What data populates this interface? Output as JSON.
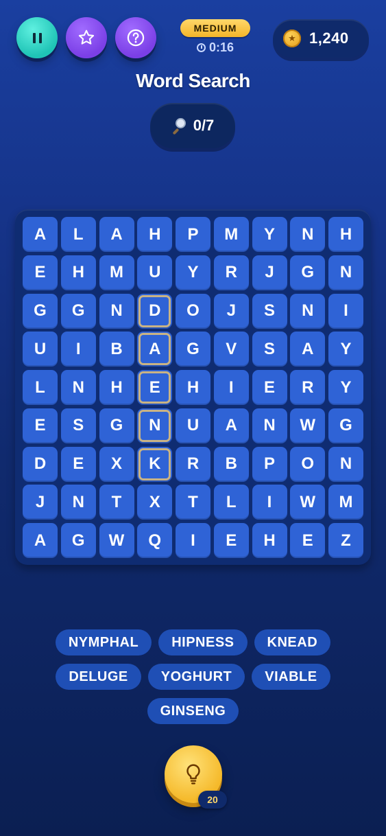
{
  "header": {
    "pause_icon": "pause-icon",
    "star_icon": "star-icon",
    "help_icon": "question-circle-icon",
    "difficulty": "MEDIUM",
    "timer": "0:16",
    "coins": "1,240"
  },
  "title": "Word Search",
  "progress": "0/7",
  "grid": [
    [
      "A",
      "L",
      "A",
      "H",
      "P",
      "M",
      "Y",
      "N",
      "H"
    ],
    [
      "E",
      "H",
      "M",
      "U",
      "Y",
      "R",
      "J",
      "G",
      "N"
    ],
    [
      "G",
      "G",
      "N",
      "D",
      "O",
      "J",
      "S",
      "N",
      "I"
    ],
    [
      "U",
      "I",
      "B",
      "A",
      "G",
      "V",
      "S",
      "A",
      "Y"
    ],
    [
      "L",
      "N",
      "H",
      "E",
      "H",
      "I",
      "E",
      "R",
      "Y"
    ],
    [
      "E",
      "S",
      "G",
      "N",
      "U",
      "A",
      "N",
      "W",
      "G"
    ],
    [
      "D",
      "E",
      "X",
      "K",
      "R",
      "B",
      "P",
      "O",
      "N"
    ],
    [
      "J",
      "N",
      "T",
      "X",
      "T",
      "L",
      "I",
      "W",
      "M"
    ],
    [
      "A",
      "G",
      "W",
      "Q",
      "I",
      "E",
      "H",
      "E",
      "Z"
    ]
  ],
  "highlighted_cells": [
    [
      2,
      3
    ],
    [
      3,
      3
    ],
    [
      4,
      3
    ],
    [
      5,
      3
    ],
    [
      6,
      3
    ]
  ],
  "words": [
    "NYMPHAL",
    "HIPNESS",
    "KNEAD",
    "DELUGE",
    "YOGHURT",
    "VIABLE",
    "GINSENG"
  ],
  "hint": {
    "icon": "lightbulb-icon",
    "count": "20"
  },
  "colors": {
    "accent_gold": "#f5b92a",
    "cell_blue": "#2f63d6",
    "teal": "#1fc4b6",
    "purple": "#7b3fe6"
  }
}
